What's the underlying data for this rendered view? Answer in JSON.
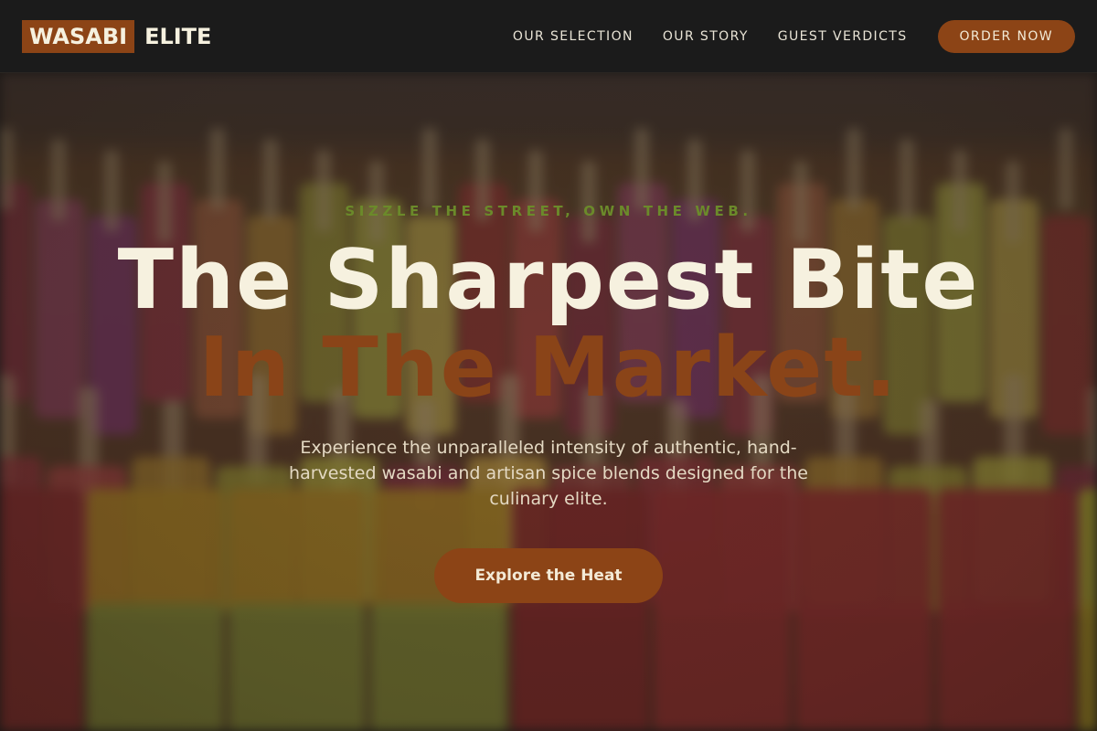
{
  "brand": {
    "logo_boxed": "WASABI",
    "logo_rest": "ELITE",
    "accent_color": "#8c4416",
    "header_bg": "#1b1b1b",
    "text_cream": "#f6f1df",
    "tagline_green": "#6b8a2a"
  },
  "nav": {
    "links": [
      "OUR SELECTION",
      "OUR STORY",
      "GUEST VERDICTS"
    ],
    "order_label": "ORDER NOW"
  },
  "hero": {
    "tagline": "SIZZLE THE STREET, OWN THE WEB.",
    "headline_line1": "The Sharpest Bite",
    "headline_line2": "In The Market.",
    "description": "Experience the unparalleled intensity of authentic, hand-harvested wasabi and artisan spice blends designed for the culinary elite.",
    "cta_label": "Explore the Heat",
    "background_image": "blurred-popsicle-display-photo"
  }
}
